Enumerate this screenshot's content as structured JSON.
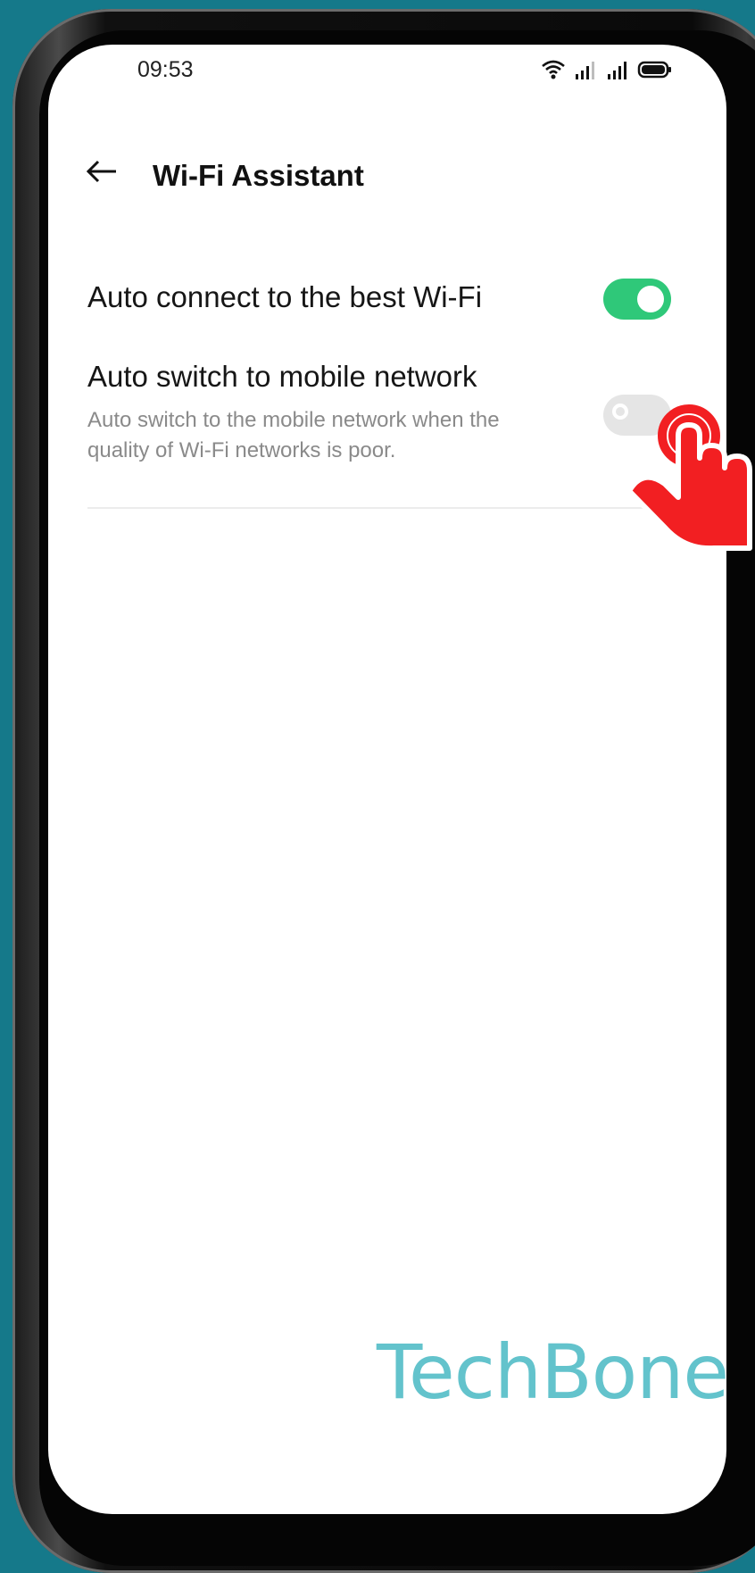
{
  "status_bar": {
    "time": "09:53",
    "icons": [
      "wifi-icon",
      "signal-icon",
      "signal-icon",
      "battery-icon"
    ]
  },
  "header": {
    "back_icon": "arrow-left-icon",
    "title": "Wi-Fi Assistant"
  },
  "settings": [
    {
      "title": "Auto connect to the best Wi-Fi",
      "enabled": true
    },
    {
      "title": "Auto switch to mobile network",
      "description": "Auto switch to the mobile network when the quality of Wi-Fi networks is poor.",
      "enabled": false
    }
  ],
  "overlay": {
    "pointer_icon": "tap-hand-icon",
    "watermark": "TechBone"
  },
  "colors": {
    "background": "#15798a",
    "toggle_on": "#2fc879",
    "toggle_off": "#e5e5e5",
    "watermark": "#63c3cc",
    "pointer": "#f21f22"
  }
}
